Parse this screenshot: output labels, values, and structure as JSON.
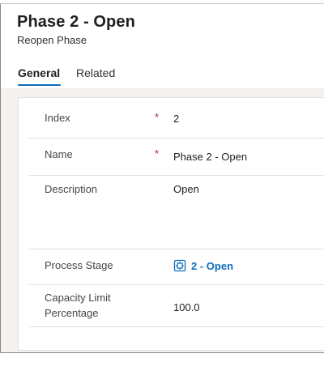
{
  "header": {
    "title": "Phase 2 - Open",
    "subtitle": "Reopen Phase"
  },
  "tabs": [
    {
      "label": "General",
      "selected": true
    },
    {
      "label": "Related",
      "selected": false
    }
  ],
  "form": {
    "required_marker": "*",
    "fields": [
      {
        "label": "Index",
        "value": "2",
        "required": true
      },
      {
        "label": "Name",
        "value": "Phase 2 - Open",
        "required": true
      },
      {
        "label": "Description",
        "value": "Open",
        "required": false
      },
      {
        "label": "Process Stage",
        "value": "2 - Open",
        "required": false,
        "type": "lookup-link",
        "icon": "process-stage-icon"
      },
      {
        "label_line1": "Capacity Limit",
        "label_line2": "Percentage",
        "value": "100.0",
        "required": false
      }
    ]
  },
  "colors": {
    "link": "#0f6cbd",
    "tab_underline": "#0f6cbd",
    "required": "#a4262c"
  }
}
